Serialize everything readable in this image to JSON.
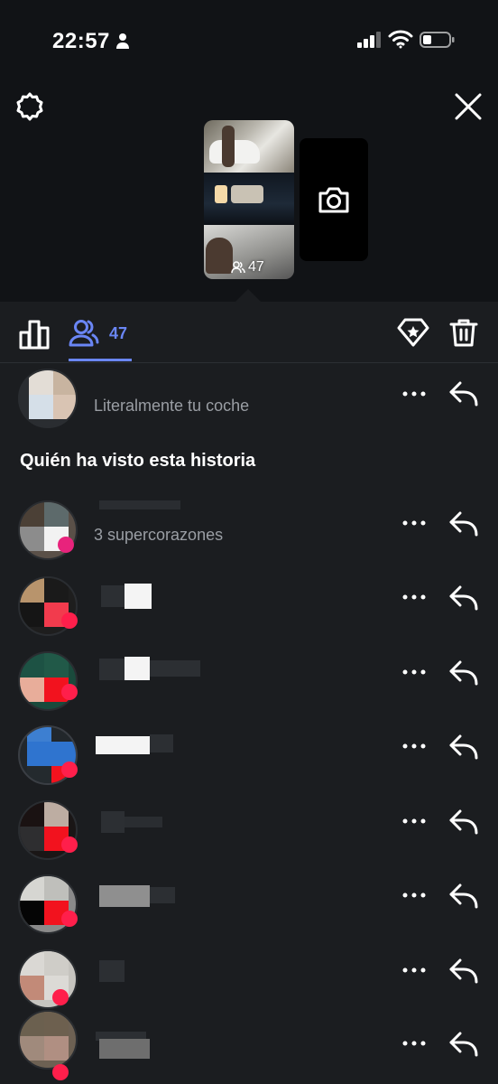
{
  "status_bar": {
    "time": "22:57"
  },
  "story_preview": {
    "viewer_count": "47"
  },
  "tabs": {
    "viewers_count": "47"
  },
  "reply_row": {
    "message": "Literalmente tu coche"
  },
  "viewers_section": {
    "title": "Quién ha visto esta historia",
    "first_viewer_subtitle": "3 supercorazones"
  },
  "colors": {
    "accent": "#6a86f5",
    "background": "#1b1d20",
    "top_background": "#111316",
    "heart": "#ff1f4b"
  },
  "icons": [
    "person-icon",
    "signal-icon",
    "wifi-icon",
    "battery-icon",
    "settings-icon",
    "close-icon",
    "camera-icon",
    "insights-icon",
    "viewers-icon",
    "highlight-icon",
    "trash-icon",
    "more-icon",
    "reply-icon"
  ]
}
